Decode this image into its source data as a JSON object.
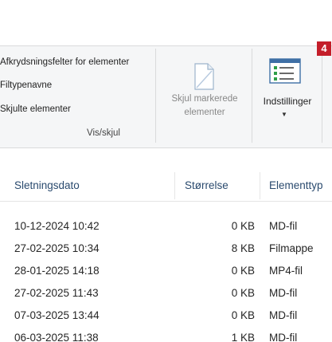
{
  "ribbon": {
    "show_hide": {
      "checkboxes": [
        "Afkrydsningsfelter for elementer",
        "Filtypenavne",
        "Skjulte elementer"
      ],
      "group_label": "Vis/skjul",
      "hide_selected_label_line1": "Skjul markerede",
      "hide_selected_label_line2": "elementer"
    },
    "settings_label": "Indstillinger",
    "callout_number": "4",
    "callout_color": "#c41e2a"
  },
  "file_list": {
    "columns": [
      "Sletningsdato",
      "Størrelse",
      "Elementtyp"
    ],
    "rows": [
      {
        "date": "10-12-2024 10:42",
        "size": "0 KB",
        "type": "MD-fil"
      },
      {
        "date": "27-02-2025 10:34",
        "size": "8 KB",
        "type": "Filmappe"
      },
      {
        "date": "28-01-2025 14:18",
        "size": "0 KB",
        "type": "MP4-fil"
      },
      {
        "date": "27-02-2025 11:43",
        "size": "0 KB",
        "type": "MD-fil"
      },
      {
        "date": "07-03-2025 13:44",
        "size": "0 KB",
        "type": "MD-fil"
      },
      {
        "date": "06-03-2025 11:38",
        "size": "1 KB",
        "type": "MD-fil"
      }
    ]
  }
}
